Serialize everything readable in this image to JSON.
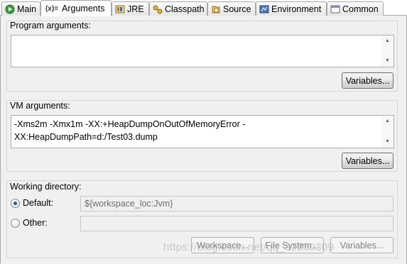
{
  "tabs": [
    {
      "label": "Main",
      "icon": "main-icon"
    },
    {
      "label": "Arguments",
      "icon": "arguments-icon",
      "active": true
    },
    {
      "label": "JRE",
      "icon": "jre-icon"
    },
    {
      "label": "Classpath",
      "icon": "classpath-icon"
    },
    {
      "label": "Source",
      "icon": "source-icon"
    },
    {
      "label": "Environment",
      "icon": "environment-icon"
    },
    {
      "label": "Common",
      "icon": "common-icon"
    }
  ],
  "arguments_icon_glyph": "(x)=",
  "program_arguments": {
    "label": "Program arguments:",
    "value": "",
    "variables_label": "Variables..."
  },
  "vm_arguments": {
    "label": "VM arguments:",
    "line1": "-Xms2m -Xmx1m -XX:+HeapDumpOnOutOfMemoryError -",
    "line2": "XX:HeapDumpPath=d:/Test03.dump",
    "variables_label": "Variables..."
  },
  "working_directory": {
    "label": "Working directory:",
    "default_label": "Default:",
    "default_value": "${workspace_loc:Jvm}",
    "default_selected": true,
    "other_label": "Other:",
    "other_value": "",
    "workspace_label": "Workspace...",
    "filesystem_label": "File System...",
    "variables_label": "Variables..."
  },
  "watermark": "https://blog.csdn.net/qq_32230309"
}
